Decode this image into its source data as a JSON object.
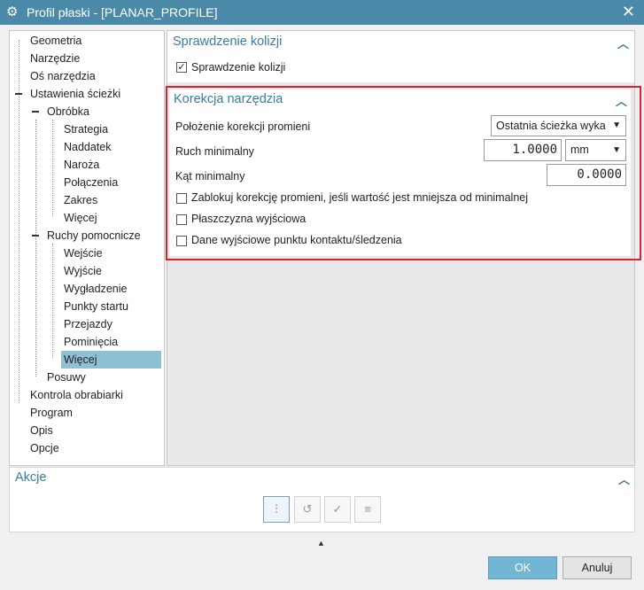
{
  "window": {
    "title": "Profil płaski - [PLANAR_PROFILE]"
  },
  "tree": {
    "items": [
      {
        "label": "Geometria"
      },
      {
        "label": "Narzędzie"
      },
      {
        "label": "Oś narzędzia"
      },
      {
        "label": "Ustawienia ścieżki"
      },
      {
        "label": "Obróbka"
      },
      {
        "label": "Strategia"
      },
      {
        "label": "Naddatek"
      },
      {
        "label": "Naroża"
      },
      {
        "label": "Połączenia"
      },
      {
        "label": "Zakres"
      },
      {
        "label": "Więcej"
      },
      {
        "label": "Ruchy pomocnicze"
      },
      {
        "label": "Wejście"
      },
      {
        "label": "Wyjście"
      },
      {
        "label": "Wygładzenie"
      },
      {
        "label": "Punkty startu"
      },
      {
        "label": "Przejazdy"
      },
      {
        "label": "Pominięcia"
      },
      {
        "label": "Więcej"
      },
      {
        "label": "Posuwy"
      },
      {
        "label": "Kontrola obrabiarki"
      },
      {
        "label": "Program"
      },
      {
        "label": "Opis"
      },
      {
        "label": "Opcje"
      }
    ],
    "selected": "Więcej"
  },
  "collision": {
    "title": "Sprawdzenie kolizji",
    "checkbox_label": "Sprawdzenie kolizji",
    "checked": true
  },
  "correction": {
    "title": "Korekcja narzędzia",
    "position_label": "Położenie korekcji promieni",
    "position_value": "Ostatnia ścieżka wyka",
    "min_move_label": "Ruch minimalny",
    "min_move_value": "1.0000",
    "min_move_unit": "mm",
    "min_angle_label": "Kąt minimalny",
    "min_angle_value": "0.0000",
    "options": [
      {
        "label": "Zablokuj korekcję promieni, jeśli wartość jest mniejsza od minimalnej",
        "checked": false
      },
      {
        "label": "Płaszczyzna wyjściowa",
        "checked": false
      },
      {
        "label": "Dane wyjściowe punktu kontaktu/śledzenia",
        "checked": false
      }
    ]
  },
  "actions": {
    "title": "Akcje"
  },
  "buttons": {
    "ok": "OK",
    "cancel": "Anuluj"
  },
  "colors": {
    "titlebar": "#4a8aa8",
    "accent": "#3a7ba6",
    "highlight": "#e0202a",
    "selection": "#8fc0d3"
  }
}
